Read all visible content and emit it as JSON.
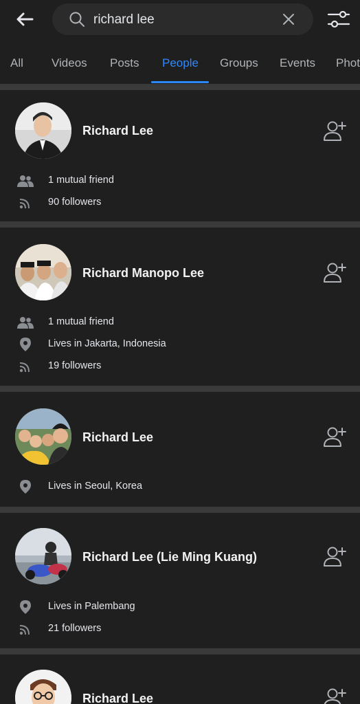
{
  "search": {
    "query": "richard lee"
  },
  "tabs": [
    "All",
    "Videos",
    "Posts",
    "People",
    "Groups",
    "Events",
    "Phot"
  ],
  "active_tab": "People",
  "results": [
    {
      "name": "Richard Lee",
      "details": [
        "1 mutual friend",
        "90 followers"
      ],
      "icons": [
        "mutual-friends-icon",
        "followers-icon"
      ]
    },
    {
      "name": "Richard Manopo Lee",
      "details": [
        "1 mutual friend",
        "Lives in Jakarta, Indonesia",
        "19 followers"
      ],
      "icons": [
        "mutual-friends-icon",
        "location-pin-icon",
        "followers-icon"
      ]
    },
    {
      "name": "Richard Lee",
      "details": [
        "Lives in Seoul, Korea"
      ],
      "icons": [
        "location-pin-icon"
      ]
    },
    {
      "name": "Richard Lee (Lie Ming Kuang)",
      "details": [
        "Lives in Palembang",
        "21 followers"
      ],
      "icons": [
        "location-pin-icon",
        "followers-icon"
      ]
    },
    {
      "name": "Richard Lee",
      "details": [],
      "icons": []
    }
  ],
  "colors": {
    "background": "#1f1f1f",
    "divider": "#3a3a3a",
    "accent": "#2d88ff",
    "secondary_text": "#b0b3b8"
  }
}
